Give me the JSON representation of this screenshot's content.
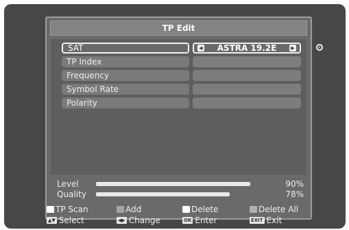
{
  "window": {
    "title": "TP Edit"
  },
  "fields": [
    {
      "label": "SAT",
      "value": "ASTRA 19.2E"
    },
    {
      "label": "TP Index"
    },
    {
      "label": "Frequency"
    },
    {
      "label": "Symbol Rate"
    },
    {
      "label": "Polarity"
    }
  ],
  "signal": {
    "level": {
      "label": "Level",
      "percent_text": "90%",
      "fraction": 0.9
    },
    "quality": {
      "label": "Quality",
      "percent_text": "78%",
      "fraction": 0.78
    }
  },
  "legend": {
    "row1": [
      {
        "label": "TP Scan",
        "color": "#ffffff"
      },
      {
        "label": "Add",
        "color": "#a5a5a5"
      },
      {
        "label": "Delete",
        "color": "#ffffff"
      },
      {
        "label": "Delete All",
        "color": "#b0b0b0"
      }
    ],
    "row2": [
      {
        "label": "Select",
        "key": "▲▼"
      },
      {
        "label": "Change",
        "key": "◀▶"
      },
      {
        "label": "Enter",
        "key": "OK"
      },
      {
        "label": "Exit",
        "key": "EXIT"
      }
    ]
  }
}
